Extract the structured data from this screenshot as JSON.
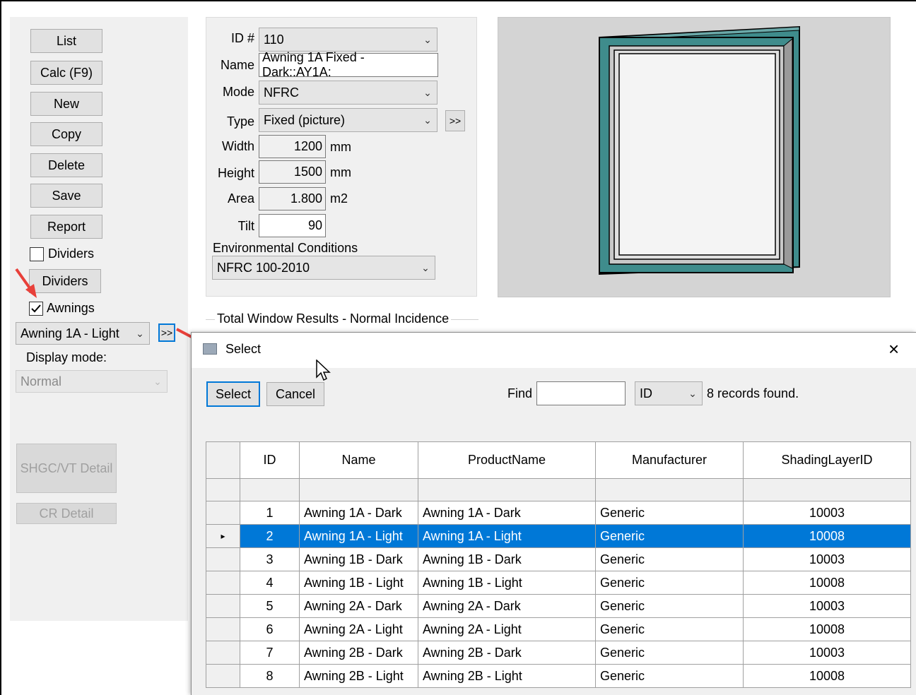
{
  "left": {
    "buttons": {
      "list": "List",
      "calc": "Calc (F9)",
      "new": "New",
      "copy": "Copy",
      "delete": "Delete",
      "save": "Save",
      "report": "Report",
      "dividers": "Dividers",
      "shgc_vt": "SHGC/VT Detail",
      "cr": "CR Detail"
    },
    "dividers_check_label": "Dividers",
    "dividers_checked": false,
    "awnings_check_label": "Awnings",
    "awnings_checked": true,
    "awning_select": "Awning 1A - Light",
    "expand_label": ">>",
    "display_mode_label": "Display mode:",
    "display_mode_value": "Normal"
  },
  "form": {
    "id_label": "ID #",
    "id_value": "110",
    "name_label": "Name",
    "name_value": "Awning 1A Fixed - Dark::AY1A:",
    "mode_label": "Mode",
    "mode_value": "NFRC",
    "type_label": "Type",
    "type_value": "Fixed (picture)",
    "type_expand": ">>",
    "width_label": "Width",
    "width_value": "1200",
    "width_unit": "mm",
    "height_label": "Height",
    "height_value": "1500",
    "height_unit": "mm",
    "area_label": "Area",
    "area_value": "1.800",
    "area_unit": "m2",
    "tilt_label": "Tilt",
    "tilt_value": "90",
    "env_label": "Environmental Conditions",
    "env_value": "NFRC 100-2010",
    "results_label": "Total Window Results - Normal Incidence"
  },
  "preview": {
    "frame_color": "#3f8c8c",
    "background": "#d4d4d4"
  },
  "dialog": {
    "title": "Select",
    "close": "×",
    "select_btn": "Select",
    "cancel_btn": "Cancel",
    "find_label": "Find",
    "find_value": "",
    "find_field": "ID",
    "records_found": "8 records found.",
    "columns": [
      "ID",
      "Name",
      "ProductName",
      "Manufacturer",
      "ShadingLayerID"
    ],
    "rows": [
      {
        "id": "1",
        "name": "Awning 1A - Dark",
        "product": "Awning 1A - Dark",
        "manufacturer": "Generic",
        "shading": "10003"
      },
      {
        "id": "2",
        "name": "Awning 1A - Light",
        "product": "Awning 1A - Light",
        "manufacturer": "Generic",
        "shading": "10008"
      },
      {
        "id": "3",
        "name": "Awning 1B - Dark",
        "product": "Awning 1B - Dark",
        "manufacturer": "Generic",
        "shading": "10003"
      },
      {
        "id": "4",
        "name": "Awning 1B - Light",
        "product": "Awning 1B - Light",
        "manufacturer": "Generic",
        "shading": "10008"
      },
      {
        "id": "5",
        "name": "Awning 2A - Dark",
        "product": "Awning 2A - Dark",
        "manufacturer": "Generic",
        "shading": "10003"
      },
      {
        "id": "6",
        "name": "Awning 2A - Light",
        "product": "Awning 2A - Light",
        "manufacturer": "Generic",
        "shading": "10008"
      },
      {
        "id": "7",
        "name": "Awning 2B - Dark",
        "product": "Awning 2B - Dark",
        "manufacturer": "Generic",
        "shading": "10003"
      },
      {
        "id": "8",
        "name": "Awning 2B - Light",
        "product": "Awning 2B - Light",
        "manufacturer": "Generic",
        "shading": "10008"
      }
    ],
    "selected_row_index": 1,
    "row_pointer": "▸",
    "selection_color": "#0078d7"
  },
  "annotation_color": "#e8403a"
}
